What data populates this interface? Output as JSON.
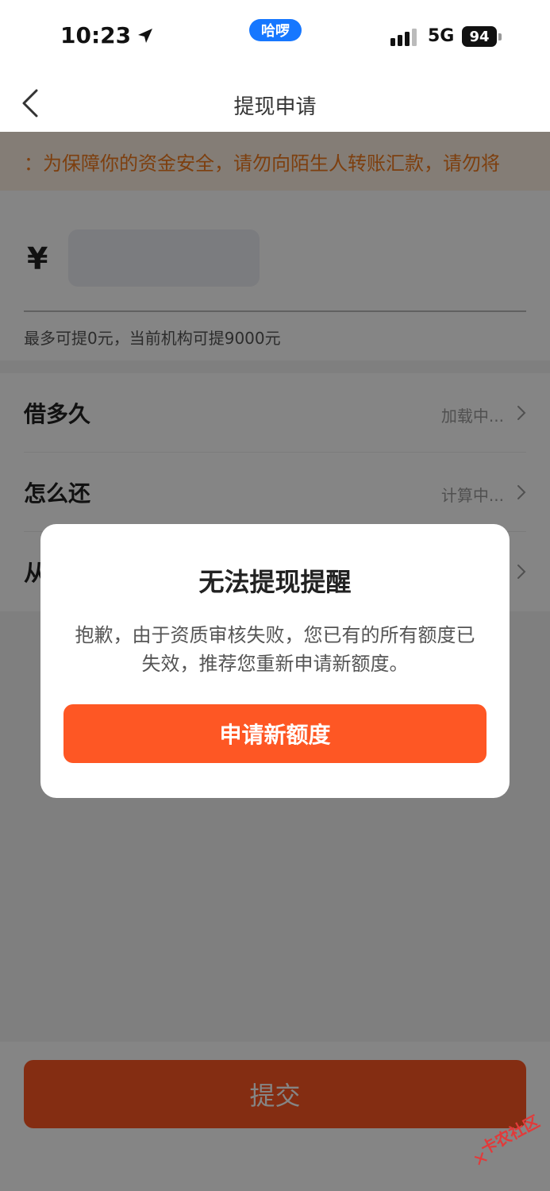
{
  "status_bar": {
    "time": "10:23",
    "app_pill": "哈啰",
    "network": "5G",
    "battery": "94"
  },
  "nav": {
    "title": "提现申请"
  },
  "notice": {
    "text": "：为保障你的资金安全，请勿向陌生人转账汇款，请勿将"
  },
  "amount": {
    "currency": "¥",
    "placeholder": "",
    "hint": "最多可提0元，当前机构可提9000元"
  },
  "options": [
    {
      "label": "借多久",
      "value": "加载中..."
    },
    {
      "label": "怎么还",
      "value": "计算中..."
    },
    {
      "label": "从",
      "value": ""
    }
  ],
  "submit": {
    "label": "提交"
  },
  "dialog": {
    "title": "无法提现提醒",
    "message": "抱歉，由于资质审核失败，您已有的所有额度已失效，推荐您重新申请新额度。",
    "button": "申请新额度"
  },
  "watermark": {
    "text": "卡农社区"
  },
  "colors": {
    "primary": "#fe5724",
    "notice_text": "#f07a1e",
    "notice_bg": "#fdf0e2",
    "pill": "#1677ff"
  }
}
